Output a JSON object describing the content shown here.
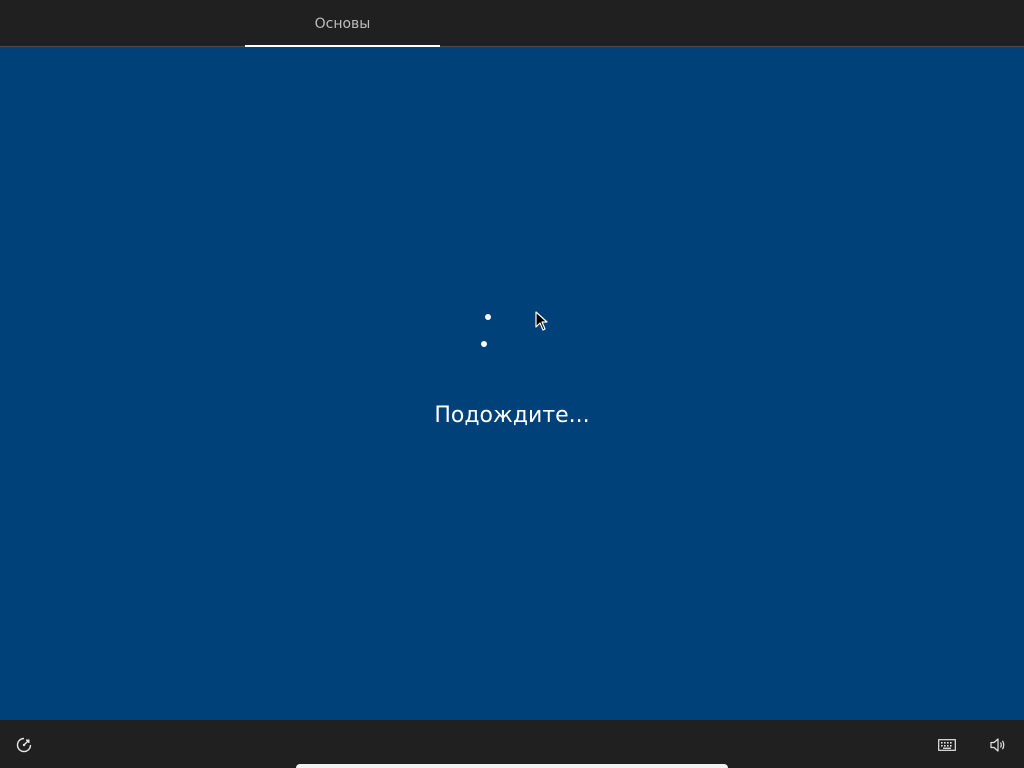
{
  "header": {
    "tabs": [
      {
        "label": "Основы",
        "active": true
      }
    ]
  },
  "main": {
    "status_text": "Подождите...",
    "background_color": "#004179"
  },
  "footer": {
    "icons": [
      "ease-of-access-icon",
      "keyboard-icon",
      "volume-icon"
    ]
  }
}
